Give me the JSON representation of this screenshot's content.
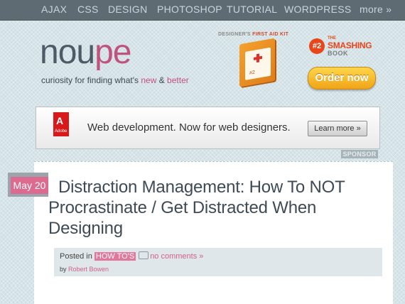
{
  "nav": {
    "items": [
      "AJAX",
      "CSS",
      "DESIGN",
      "PHOTOSHOP",
      "TUTORIAL",
      "WORDPRESS",
      "more »"
    ]
  },
  "logo": {
    "word_a": "nou",
    "word_b": "pe",
    "tagline_a": "curiosity for finding what's ",
    "tagline_new": "new",
    "tagline_amp": " & ",
    "tagline_better": "better"
  },
  "ad": {
    "kit_label_a": "DESIGNER'S ",
    "kit_label_b": "FIRST AID KIT",
    "book_num": "#2",
    "badge": "#2",
    "the": "THE",
    "title": "SMASHING",
    "subtitle": "BOOK",
    "order": "Order now"
  },
  "banner": {
    "logo_letter": "A",
    "logo_text": "Adobe",
    "headline": "Web development. Now for web designers.",
    "button": "Learn more »",
    "sponsor": "SPONSOR"
  },
  "post": {
    "date": "May 20",
    "title": "Distraction Management: How To NOT Procrastinate / Get Distracted When Designing",
    "posted_in": "Posted in ",
    "category": "HOW TO'S",
    "comments": "no comments »",
    "by": "by ",
    "author": "Robert Bowen"
  },
  "colors": {
    "nav_bg": "#5f6b73",
    "accent_pink": "#dd6b90",
    "page_bg": "#cfdfe4"
  }
}
